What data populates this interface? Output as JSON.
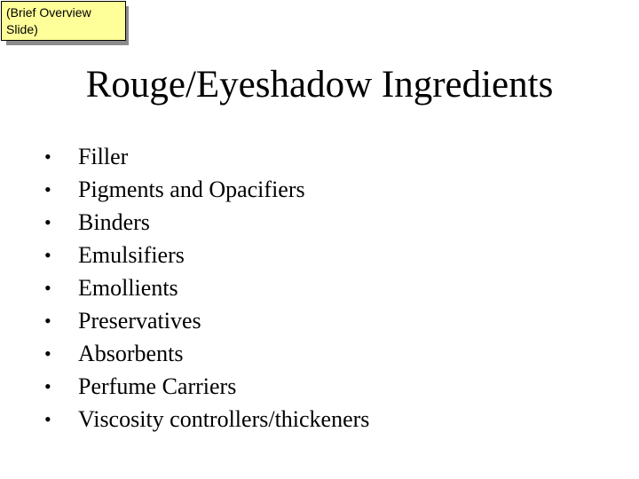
{
  "note": {
    "lines": [
      "(Brief Overview",
      "Slide)"
    ]
  },
  "slide": {
    "title": "Rouge/Eyeshadow Ingredients",
    "bullet_glyph": "•",
    "items": [
      "Filler",
      "Pigments and Opacifiers",
      "Binders",
      "Emulsifiers",
      "Emollients",
      "Preservatives",
      "Absorbents",
      "Perfume Carriers",
      "Viscosity controllers/thickeners"
    ]
  },
  "colors": {
    "note_background": "#ffff99",
    "note_shadow": "#8c8c8c",
    "text": "#000000",
    "background": "#ffffff"
  }
}
